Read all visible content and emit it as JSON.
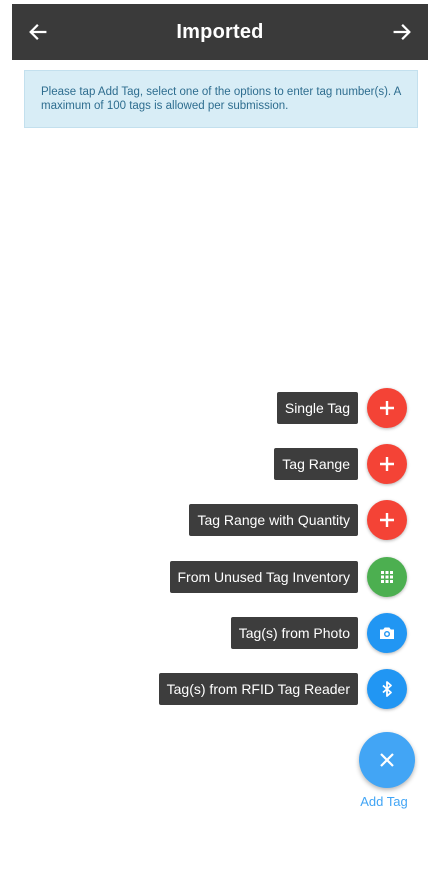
{
  "header": {
    "title": "Imported",
    "back_icon": "arrow-left-icon",
    "forward_icon": "arrow-right-icon"
  },
  "info": {
    "message": "Please tap Add Tag, select one of the options to enter tag number(s). A maximum of 100 tags is allowed per submission."
  },
  "fab_menu": {
    "items": [
      {
        "label": "Single Tag",
        "icon": "plus-icon",
        "color": "#f44336"
      },
      {
        "label": "Tag Range",
        "icon": "plus-icon",
        "color": "#f44336"
      },
      {
        "label": "Tag Range with Quantity",
        "icon": "plus-icon",
        "color": "#f44336"
      },
      {
        "label": "From Unused Tag Inventory",
        "icon": "grid-icon",
        "color": "#4caf50"
      },
      {
        "label": "Tag(s) from Photo",
        "icon": "camera-icon",
        "color": "#2196f3"
      },
      {
        "label": "Tag(s) from RFID Tag Reader",
        "icon": "bluetooth-icon",
        "color": "#2196f3"
      }
    ],
    "main_button": {
      "label": "Add Tag",
      "icon": "close-icon",
      "color": "#42a5f5"
    }
  }
}
